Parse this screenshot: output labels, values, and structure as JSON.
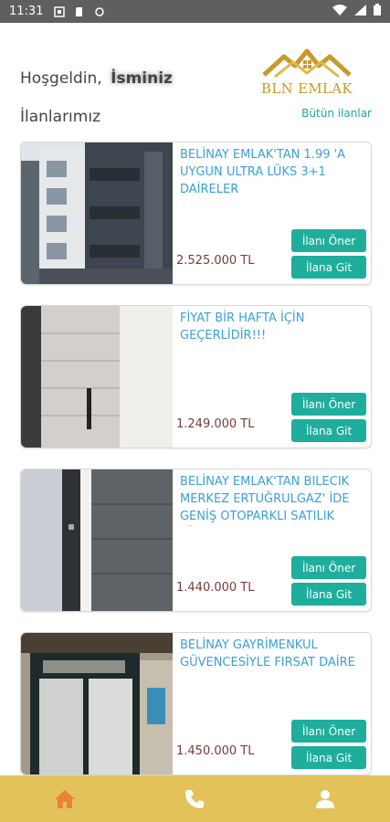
{
  "status_bar": {
    "time": "11:31"
  },
  "header": {
    "greeting": "Hoşgeldin,",
    "user_name": "İsminiz",
    "logo_text": "BLN EMLAK"
  },
  "section": {
    "title": "İlanlarımız",
    "all_link": "Bütün ilanlar"
  },
  "listings": [
    {
      "title": "BELİNAY EMLAK'TAN 1.99 'A UYGUN ULTRA LÜKS 3+1 DAİRELER",
      "price": "2.525.000 TL",
      "recommend_label": "İlanı Öner",
      "go_label": "İlana Git"
    },
    {
      "title": "FİYAT BİR HAFTA İÇİN GEÇERLİDİR!!!",
      "price": "1.249.000 TL",
      "recommend_label": "İlanı Öner",
      "go_label": "İlana Git"
    },
    {
      "title": "BELİNAY EMLAK'TAN Bilecik Merkez ERTUĞRULGAZ' İDE GENİŞ OTOPARKLI SATILIK LÜKS ...",
      "price": "1.440.000 TL",
      "recommend_label": "İlanı Öner",
      "go_label": "İlana Git"
    },
    {
      "title": "BELİNAY GAYRİMENKUL GÜVENCESİYLE FIRSAT DAİRE",
      "price": "1.450.000 TL",
      "recommend_label": "İlanı Öner",
      "go_label": "İlana Git"
    }
  ],
  "bottom_nav": [
    {
      "icon": "home-icon",
      "active": true
    },
    {
      "icon": "phone-icon",
      "active": false
    },
    {
      "icon": "person-icon",
      "active": false
    }
  ],
  "colors": {
    "accent": "#1fae9c",
    "title_blue": "#3aa0d8",
    "nav_bg": "#e3c25a",
    "nav_active": "#e8833a",
    "logo_gold": "#c89a2a"
  }
}
